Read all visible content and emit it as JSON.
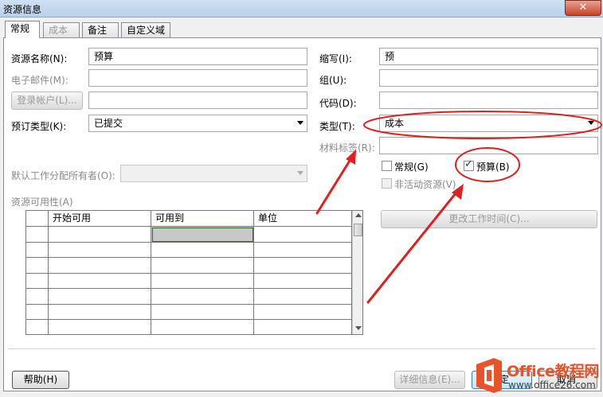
{
  "window": {
    "title": "资源信息",
    "close_glyph": "✕"
  },
  "tabs": [
    {
      "label": "常规",
      "active": true
    },
    {
      "label": "成本",
      "disabled": true
    },
    {
      "label": "备注"
    },
    {
      "label": "自定义域"
    }
  ],
  "form": {
    "name_label": "资源名称(N):",
    "name_value": "预算",
    "email_label": "电子邮件(M):",
    "email_value": "",
    "login_button": "登录帐户(L)...",
    "login_value": "",
    "booking_label": "预订类型(K):",
    "booking_value": "已提交",
    "initials_label": "缩写(I):",
    "initials_value": "预",
    "group_label": "组(U):",
    "group_value": "",
    "code_label": "代码(D):",
    "code_value": "",
    "type_label": "类型(T):",
    "type_value": "成本",
    "material_label": "材料标签(R):",
    "material_value": "",
    "generic_label": "常规(G)",
    "generic_checked": false,
    "budget_label": "预算(B)",
    "budget_checked": true,
    "inactive_label": "非活动资源(V)",
    "inactive_checked": false,
    "owner_label": "默认工作分配所有者(O):",
    "owner_value": ""
  },
  "availability": {
    "section_label": "资源可用性(A)",
    "columns": [
      "开始可用",
      "可用到",
      "单位"
    ],
    "row_count": 7
  },
  "buttons": {
    "change_working_time": "更改工作时间(C)...",
    "help": "帮助(H)",
    "details": "详细信息(E)...",
    "ok_partial": "定",
    "cancel_partial": "取消"
  },
  "watermark": {
    "brand": "Office教程网",
    "url": "www.office26.com"
  },
  "colors": {
    "annotation_red": "#e02020",
    "title_bg": "#c9dcf0",
    "brand_orange": "#e8532a"
  }
}
